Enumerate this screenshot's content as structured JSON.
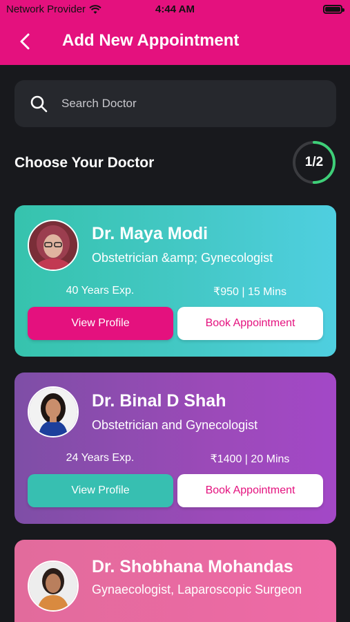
{
  "status_bar": {
    "carrier": "Network Provider",
    "time": "4:44 AM"
  },
  "header": {
    "title": "Add New Appointment",
    "background": "#e4117e"
  },
  "search": {
    "placeholder": "Search Doctor"
  },
  "section": {
    "title": "Choose Your Doctor",
    "step_text": "1/2",
    "step_progress": 0.5
  },
  "doctors": [
    {
      "name": "Dr. Maya Modi",
      "specialty": "Obstetrician &amp; Gynecologist",
      "experience": "40 Years Exp.",
      "fee": "₹950 | 15 Mins",
      "view_label": "View Profile",
      "book_label": "Book Appointment",
      "view_button_color": "#e4117e"
    },
    {
      "name": "Dr. Binal D Shah",
      "specialty": "Obstetrician and Gynecologist",
      "experience": "24 Years Exp.",
      "fee": "₹1400 | 20 Mins",
      "view_label": "View Profile",
      "book_label": "Book Appointment",
      "view_button_color": "#37bfb1"
    },
    {
      "name": "Dr. Shobhana Mohandas",
      "specialty": "Gynaecologist, Laparoscopic Surgeon"
    }
  ]
}
